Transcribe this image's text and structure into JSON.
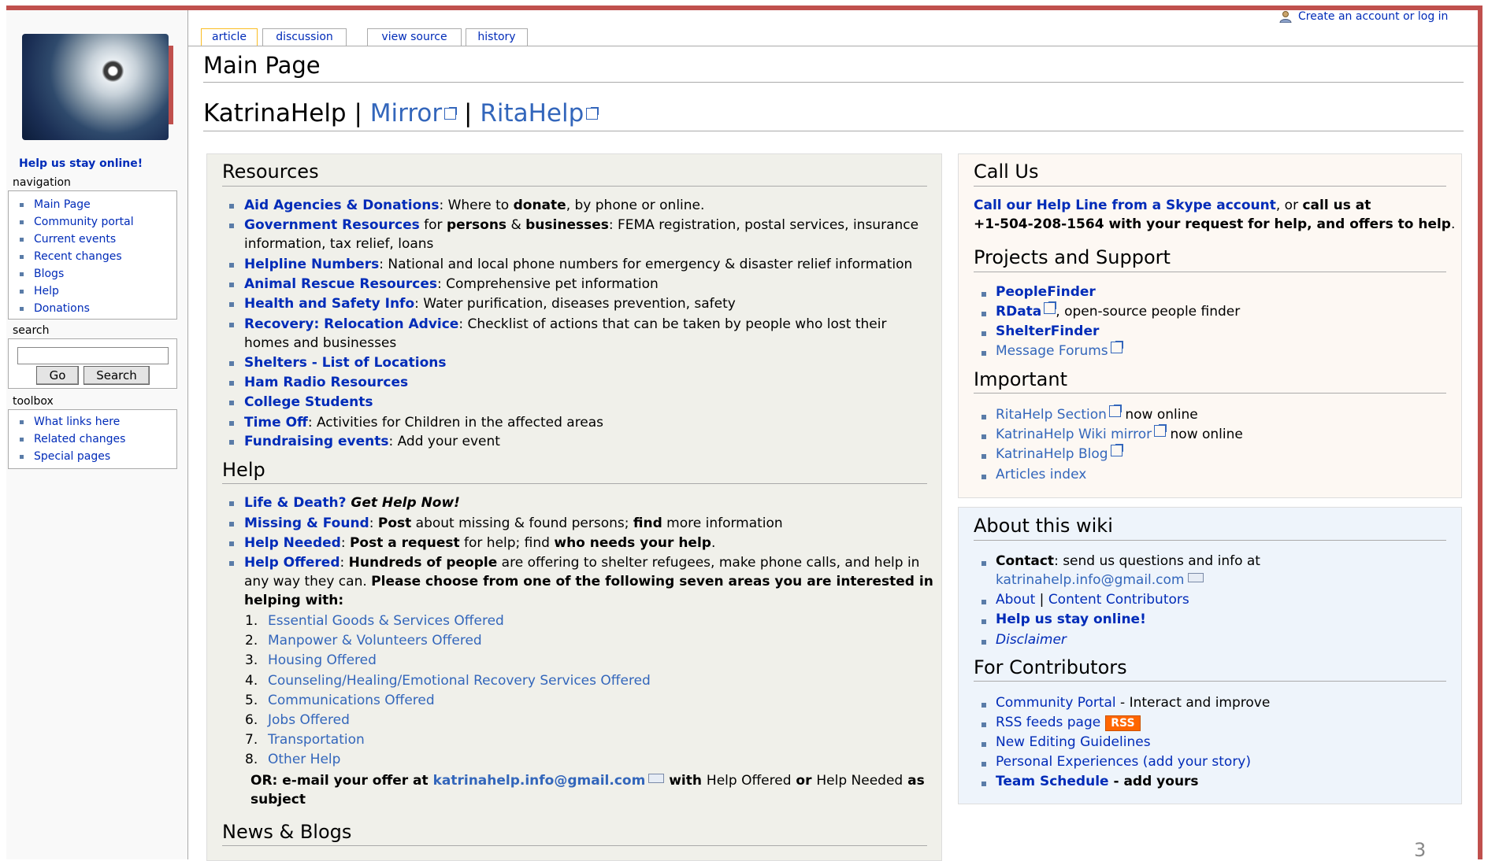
{
  "user": {
    "login": "Create an account or log in"
  },
  "tabs": [
    "article",
    "discussion",
    "view source",
    "history"
  ],
  "sidebar": {
    "help_online": "Help us stay online!",
    "nav_title": "navigation",
    "nav_items": [
      "Main Page",
      "Community portal",
      "Current events",
      "Recent changes",
      "Blogs",
      "Help",
      "Donations"
    ],
    "search_title": "search",
    "go": "Go",
    "search": "Search",
    "toolbox_title": "toolbox",
    "toolbox_items": [
      "What links here",
      "Related changes",
      "Special pages"
    ]
  },
  "page": {
    "title": "Main Page",
    "heading_a": "KatrinaHelp",
    "sep": "|",
    "heading_b": "Mirror",
    "heading_c": "RitaHelp"
  },
  "resources": {
    "title": "Resources",
    "items": [
      {
        "link": "Aid Agencies & Donations",
        "t1": ": Where to ",
        "b1": "donate",
        "t2": ", by phone or online."
      },
      {
        "link": "Government Resources",
        "t1": " for ",
        "b1": "persons",
        "t2": " & ",
        "b2": "businesses",
        "t3": ": FEMA registration, postal services, insurance",
        "line2": "information, tax relief, loans"
      },
      {
        "link": "Helpline Numbers",
        "t1": ": National and local phone numbers for emergency & disaster relief information"
      },
      {
        "link": "Animal Rescue Resources",
        "t1": ": Comprehensive pet information"
      },
      {
        "link": "Health and Safety Info",
        "t1": ": Water purification, diseases prevention, safety"
      },
      {
        "link": "Recovery: Relocation Advice",
        "t1": ": Checklist of actions that can be taken by people who lost their",
        "line2": "homes and businesses"
      },
      {
        "link": "Shelters - List of Locations"
      },
      {
        "link": "Ham Radio Resources"
      },
      {
        "link": "College Students"
      },
      {
        "link": "Time Off",
        "t1": ": Activities for Children in the affected areas"
      },
      {
        "link": "Fundraising events",
        "t1": ": Add your event"
      }
    ]
  },
  "help": {
    "title": "Help",
    "i1_link": "Life & Death?",
    "i1_b": " Get Help Now!",
    "i2_link": "Missing & Found",
    "i2_t1": ": ",
    "i2_b1": "Post",
    "i2_t2": " about missing & found persons; ",
    "i2_b2": "find",
    "i2_t3": " more information",
    "i3_link": "Help Needed",
    "i3_t1": ": ",
    "i3_b1": "Post a request",
    "i3_t2": " for help; find ",
    "i3_b2": "who needs your help",
    "i3_t3": ".",
    "i4_link": "Help Offered",
    "i4_t1": ": ",
    "i4_b1": "Hundreds of people",
    "i4_t2": " are offering to shelter refugees, make phone calls, and help in",
    "i4_line2a": "any way they can. ",
    "i4_line2b": "Please choose from one of the following seven areas you are interested in",
    "i4_line3": "helping with:",
    "numbered": [
      "Essential Goods & Services Offered",
      "Manpower & Volunteers Offered",
      "Housing Offered",
      "Counseling/Healing/Emotional Recovery Services Offered",
      "Communications Offered",
      "Jobs Offered",
      "Transportation",
      "Other Help"
    ],
    "or_b1": "OR: e-mail your offer at ",
    "or_mail": "katrinahelp.info@gmail.com",
    "or_b2": " with ",
    "or_t1": "Help Offered",
    "or_b3": " or ",
    "or_t2": "Help Needed",
    "or_b4": " as",
    "or_line2": "subject"
  },
  "news": {
    "title": "News & Blogs"
  },
  "call": {
    "title": "Call Us",
    "link": "Call our Help Line from a Skype account",
    "t1": ", or ",
    "b1": "call us at",
    "line2": "+1-504-208-1564 with your request for help, and offers to help",
    "t2": "."
  },
  "projects": {
    "title": "Projects and Support",
    "i1": "PeopleFinder",
    "i2_link": "RData",
    "i2_t": ", open-source people finder",
    "i3": "ShelterFinder",
    "i4": "Message Forums"
  },
  "important": {
    "title": "Important",
    "i1_link": "RitaHelp Section",
    "i1_t": " now online",
    "i2_link": "KatrinaHelp Wiki mirror",
    "i2_t": " now online",
    "i3": "KatrinaHelp Blog",
    "i4": "Articles index"
  },
  "about": {
    "title": "About this wiki",
    "contact_b": "Contact",
    "contact_t": ": send us questions and info at",
    "email": "katrinahelp.info@gmail.com",
    "about": "About",
    "sep": "|",
    "contrib": "Content Contributors",
    "help_online": "Help us stay online!",
    "disclaimer": "Disclaimer"
  },
  "contributors": {
    "title": "For Contributors",
    "i1_link": "Community Portal",
    "i1_t": " - Interact and improve",
    "i2_link": "RSS feeds page",
    "rss": "RSS",
    "i3": "New Editing Guidelines",
    "i4": "Personal Experiences (add your story)",
    "i5_link": "Team Schedule",
    "i5_t": " - add yours"
  },
  "page_number": "3"
}
